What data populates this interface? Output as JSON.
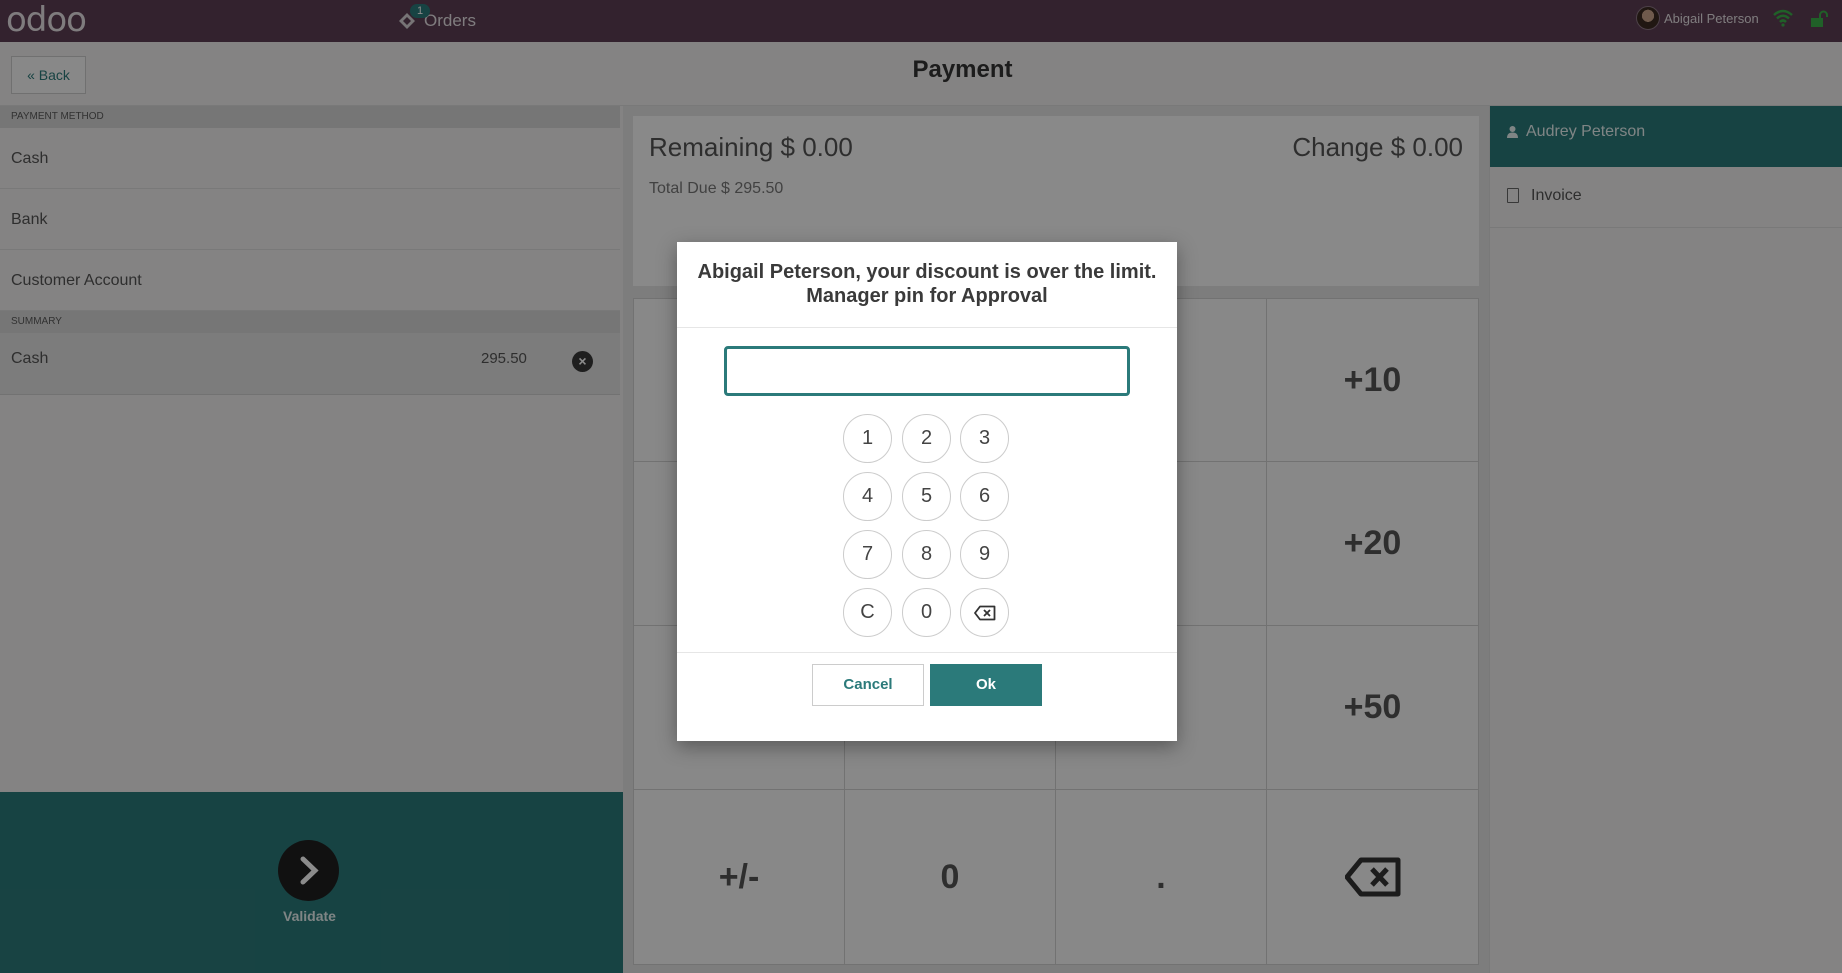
{
  "navbar": {
    "logo": "odoo",
    "orders_label": "Orders",
    "orders_badge": "1",
    "user_name": "Abigail Peterson",
    "icons": [
      "orders-icon",
      "avatar",
      "wifi-icon",
      "lock-open-icon"
    ]
  },
  "header": {
    "back_label": "« Back",
    "title": "Payment"
  },
  "left": {
    "payment_method_label": "PAYMENT METHOD",
    "methods": [
      "Cash",
      "Bank",
      "Customer Account"
    ],
    "summary_label": "SUMMARY",
    "summary": [
      {
        "name": "Cash",
        "amount": "295.50"
      }
    ],
    "validate_label": "Validate"
  },
  "totals": {
    "remaining": "Remaining $ 0.00",
    "change": "Change $ 0.00",
    "total_due": "Total Due  $ 295.50"
  },
  "numpad": {
    "keys": [
      "+10",
      "+20",
      "+50",
      "+/-",
      "0",
      "."
    ],
    "backspace_icon": "backspace-icon"
  },
  "right": {
    "customer": "Audrey Peterson",
    "invoice": "Invoice"
  },
  "modal": {
    "title_line1": "Abigail Peterson, your discount is over the limit.",
    "title_line2": "Manager pin for Approval",
    "pin_value": "",
    "keys": [
      "1",
      "2",
      "3",
      "4",
      "5",
      "6",
      "7",
      "8",
      "9",
      "C",
      "0"
    ],
    "cancel_label": "Cancel",
    "ok_label": "Ok"
  },
  "colors": {
    "navbar": "#5d3f54",
    "accent": "#2b7a7a",
    "validate_bg": "#2b7a7a"
  }
}
